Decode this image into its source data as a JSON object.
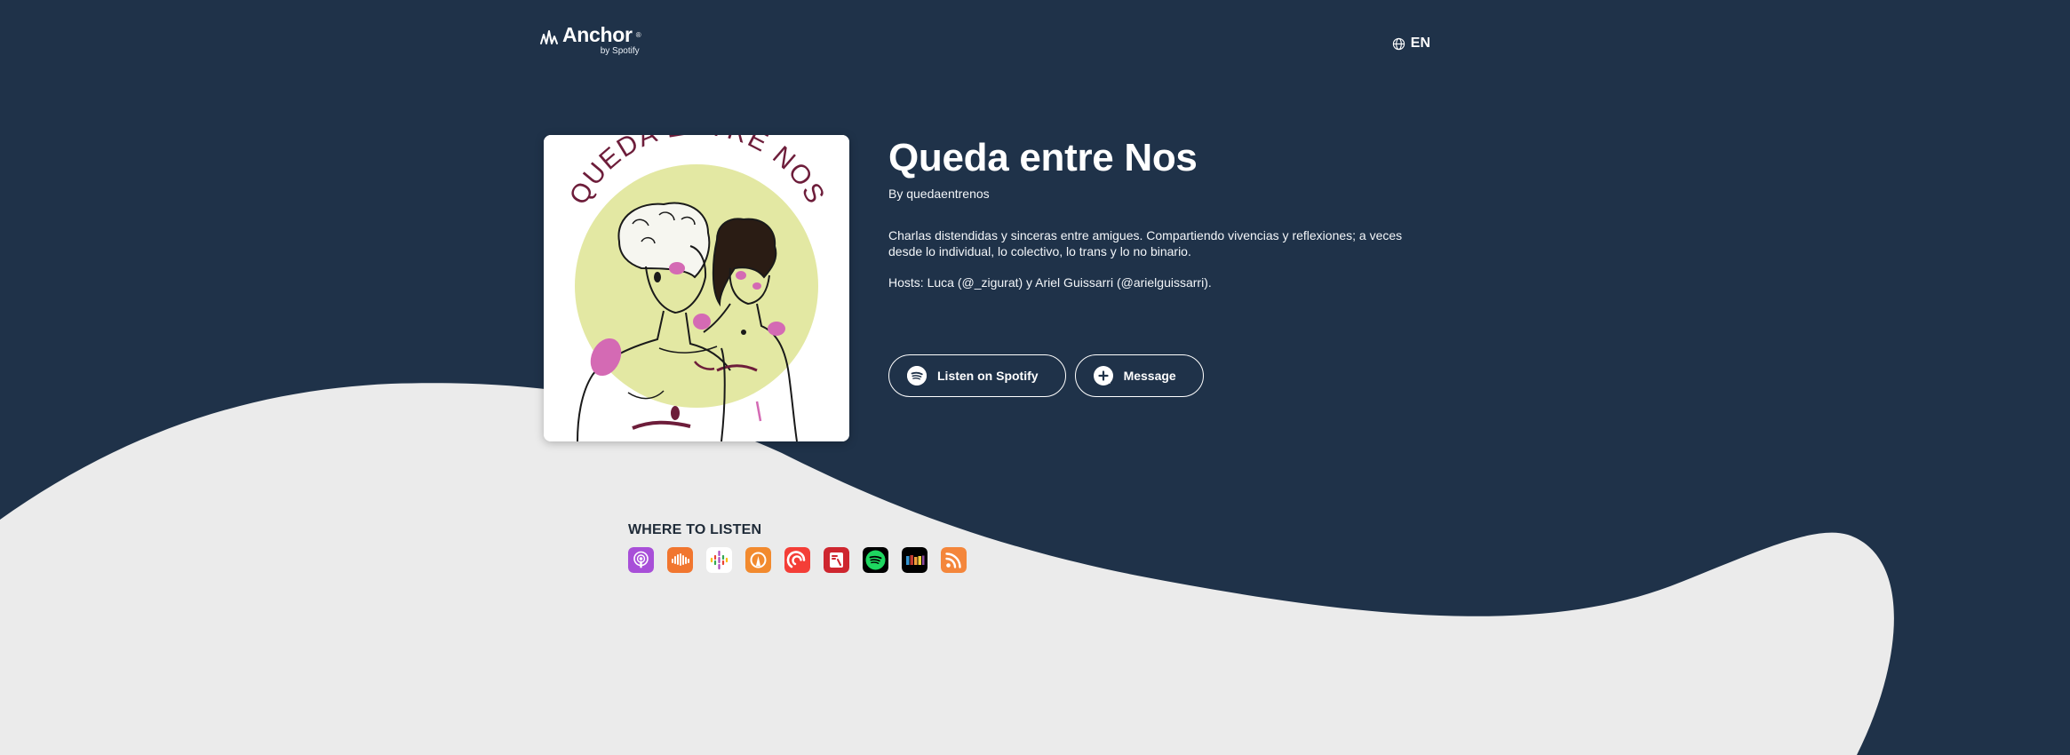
{
  "header": {
    "brand": "Anchor",
    "brand_sub": "by Spotify",
    "language": "EN"
  },
  "podcast": {
    "title": "Queda entre Nos",
    "author": "By quedaentrenos",
    "cover_text": "QUEDA ENTRE NOS",
    "description": "Charlas distendidas y sinceras entre amigues. Compartiendo vivencias y reflexiones; a veces desde lo individual, lo colectivo, lo trans y lo no binario.",
    "hosts": "Hosts: Luca (@_zigurat) y Ariel Guissarri (@arielguissarri)."
  },
  "actions": {
    "spotify_label": "Listen on Spotify",
    "message_label": "Message"
  },
  "where_to_listen": {
    "title": "WHERE TO LISTEN",
    "platforms": [
      {
        "name": "apple-podcasts",
        "color": "#a84fd8"
      },
      {
        "name": "castbox",
        "color": "#f1762f"
      },
      {
        "name": "google-podcasts",
        "color": "#ffffff"
      },
      {
        "name": "overcast",
        "color": "#f28a2e"
      },
      {
        "name": "pocket-casts",
        "color": "#f43e37"
      },
      {
        "name": "radiopublic",
        "color": "#ce262f"
      },
      {
        "name": "spotify",
        "color": "#1ed760"
      },
      {
        "name": "stitcher",
        "color": "#000000"
      },
      {
        "name": "rss",
        "color": "#f4863b"
      }
    ]
  },
  "colors": {
    "background": "#1f3249",
    "wave": "#ebebeb",
    "cover_sun": "#e3e8a3",
    "cover_text": "#6d1d3a",
    "blush": "#d46ab4"
  }
}
